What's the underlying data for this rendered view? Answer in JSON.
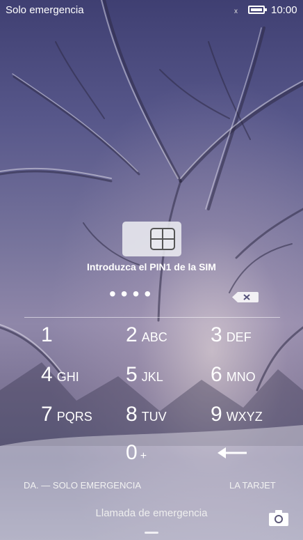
{
  "status_bar": {
    "carrier": "Solo emergencia",
    "signal": "x",
    "time": "10:00"
  },
  "sim_prompt": "Introduzca el PIN1 de la SIM",
  "pin_dots": "••••",
  "keypad": [
    {
      "digit": "1",
      "letters": ""
    },
    {
      "digit": "2",
      "letters": "ABC"
    },
    {
      "digit": "3",
      "letters": "DEF"
    },
    {
      "digit": "4",
      "letters": "GHI"
    },
    {
      "digit": "5",
      "letters": "JKL"
    },
    {
      "digit": "6",
      "letters": "MNO"
    },
    {
      "digit": "7",
      "letters": "PQRS"
    },
    {
      "digit": "8",
      "letters": "TUV"
    },
    {
      "digit": "9",
      "letters": "WXYZ"
    },
    {
      "digit": "0",
      "letters": "+"
    }
  ],
  "footer": {
    "emergency_state": "DA. — SOLO EMERGENCIA",
    "sim_state": "LA TARJET",
    "emergency_call": "Llamada de emergencia"
  },
  "icons": {
    "sim": "sim-card-icon",
    "delete": "backspace-icon",
    "enter": "enter-arrow-icon",
    "camera": "camera-icon"
  }
}
